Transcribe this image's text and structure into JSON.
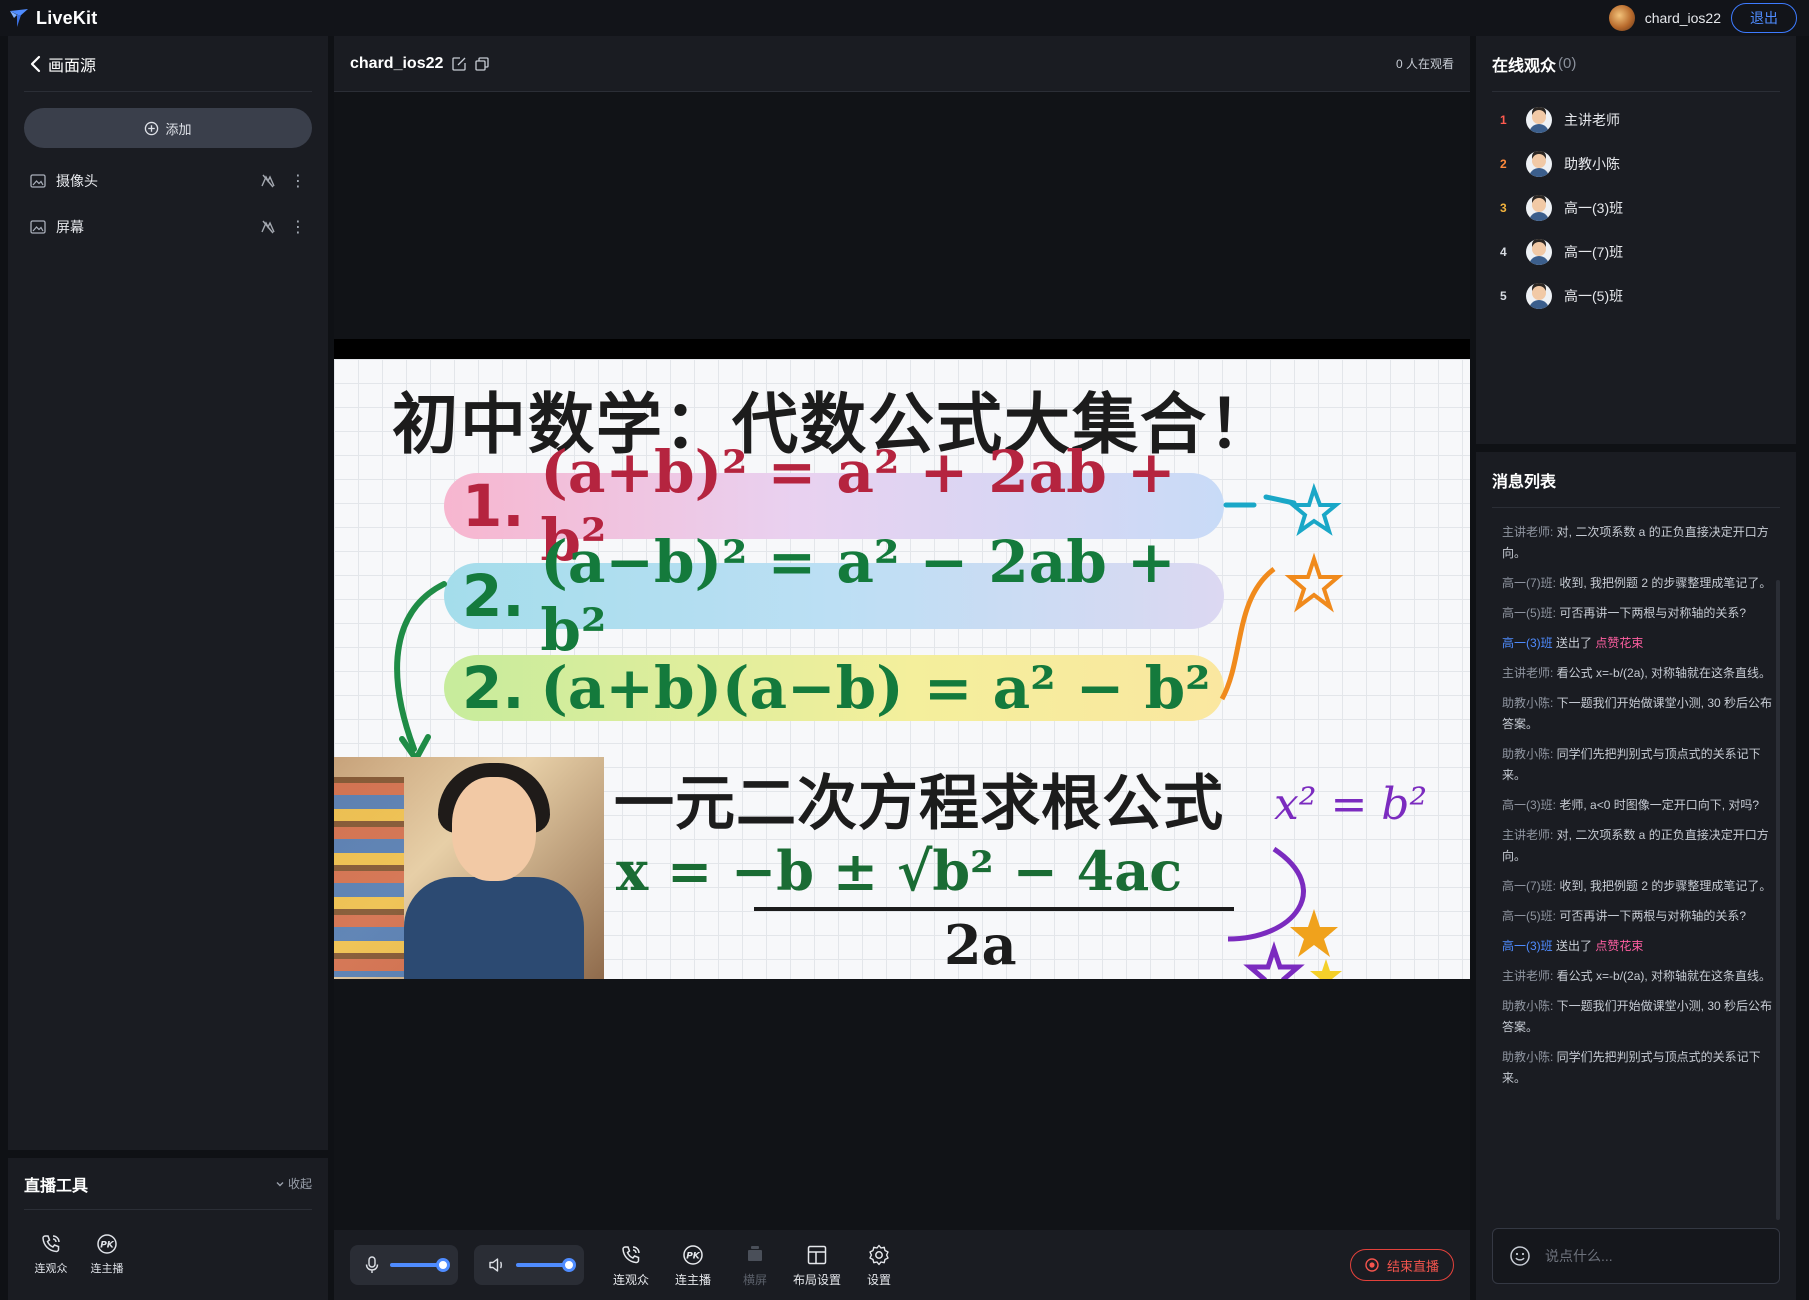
{
  "app": {
    "brand": "LiveKit"
  },
  "user": {
    "name": "chard_ios22",
    "logout_label": "退出"
  },
  "sources_panel": {
    "title": "画面源",
    "add_label": "添加",
    "items": [
      {
        "label": "摄像头"
      },
      {
        "label": "屏幕"
      }
    ]
  },
  "tools_panel": {
    "title": "直播工具",
    "collapse_label": "收起",
    "tools": [
      {
        "label": "连观众"
      },
      {
        "label": "连主播"
      }
    ]
  },
  "room": {
    "name": "chard_ios22",
    "watching": "0 人在观看"
  },
  "slide": {
    "title": "初中数学：代数公式大集合！",
    "formulas": [
      {
        "num": "1.",
        "text": "(a+b)² = a² + 2ab + b²"
      },
      {
        "num": "2.",
        "text": "(a−b)² = a² − 2ab + b²"
      },
      {
        "num": "2.",
        "text": "(a+b)(a−b) = a² − b²"
      }
    ],
    "section2": "一元二次方程求根公式",
    "quad_numerator": "x =  −b ± √b² − 4ac",
    "quad_denominator": "2a",
    "side_note": "x² = b²"
  },
  "center_toolbar": {
    "mic_level": 1.0,
    "speaker_level": 1.0,
    "tools": [
      {
        "label": "连观众",
        "disabled": false
      },
      {
        "label": "连主播",
        "disabled": false
      },
      {
        "label": "横屏",
        "disabled": true
      },
      {
        "label": "布局设置",
        "disabled": false
      },
      {
        "label": "设置",
        "disabled": false
      }
    ],
    "end_label": "结束直播"
  },
  "viewers_panel": {
    "title": "在线观众",
    "count": "(0)",
    "viewers": [
      {
        "rank": "1",
        "name": "主讲老师",
        "rank_color": "#ff5a4f"
      },
      {
        "rank": "2",
        "name": "助教小陈",
        "rank_color": "#ff8a3d"
      },
      {
        "rank": "3",
        "name": "高一(3)班",
        "rank_color": "#f3b33d"
      },
      {
        "rank": "4",
        "name": "高一(7)班",
        "rank_color": "#d8dce3"
      },
      {
        "rank": "5",
        "name": "高一(5)班",
        "rank_color": "#d8dce3"
      }
    ]
  },
  "messages_panel": {
    "title": "消息列表",
    "placeholder": "说点什么...",
    "messages": [
      {
        "who": "主讲老师:",
        "text": " 对, 二次项系数 a 的正负直接决定开口方向。"
      },
      {
        "who": "高一(7)班:",
        "text": " 收到, 我把例题 2 的步骤整理成笔记了。"
      },
      {
        "who": "高一(5)班:",
        "text": " 可否再讲一下两根与对称轴的关系?"
      },
      {
        "gift_who": "高一(3)班",
        "text": " 送出了 ",
        "gift": "点赞花束"
      },
      {
        "who": "主讲老师:",
        "text": " 看公式 x=-b/(2a), 对称轴就在这条直线。"
      },
      {
        "who": "助教小陈:",
        "text": " 下一题我们开始做课堂小测, 30 秒后公布答案。"
      },
      {
        "who": "助教小陈:",
        "text": " 同学们先把判别式与顶点式的关系记下来。"
      },
      {
        "who": "高一(3)班:",
        "text": " 老师, a<0 时图像一定开口向下, 对吗?"
      },
      {
        "who": "主讲老师:",
        "text": " 对, 二次项系数 a 的正负直接决定开口方向。"
      },
      {
        "who": "高一(7)班:",
        "text": " 收到, 我把例题 2 的步骤整理成笔记了。"
      },
      {
        "who": "高一(5)班:",
        "text": " 可否再讲一下两根与对称轴的关系?"
      },
      {
        "gift_who": "高一(3)班",
        "text": " 送出了 ",
        "gift": "点赞花束"
      },
      {
        "who": "主讲老师:",
        "text": " 看公式 x=-b/(2a), 对称轴就在这条直线。"
      },
      {
        "who": "助教小陈:",
        "text": " 下一题我们开始做课堂小测, 30 秒后公布答案。"
      },
      {
        "who": "助教小陈:",
        "text": " 同学们先把判别式与顶点式的关系记下来。"
      }
    ]
  },
  "colors": {
    "accent": "#4f8cff",
    "danger": "#f3544d",
    "gift": "#ff5fa2",
    "panel": "#1a1c22",
    "background": "#0f1115"
  }
}
